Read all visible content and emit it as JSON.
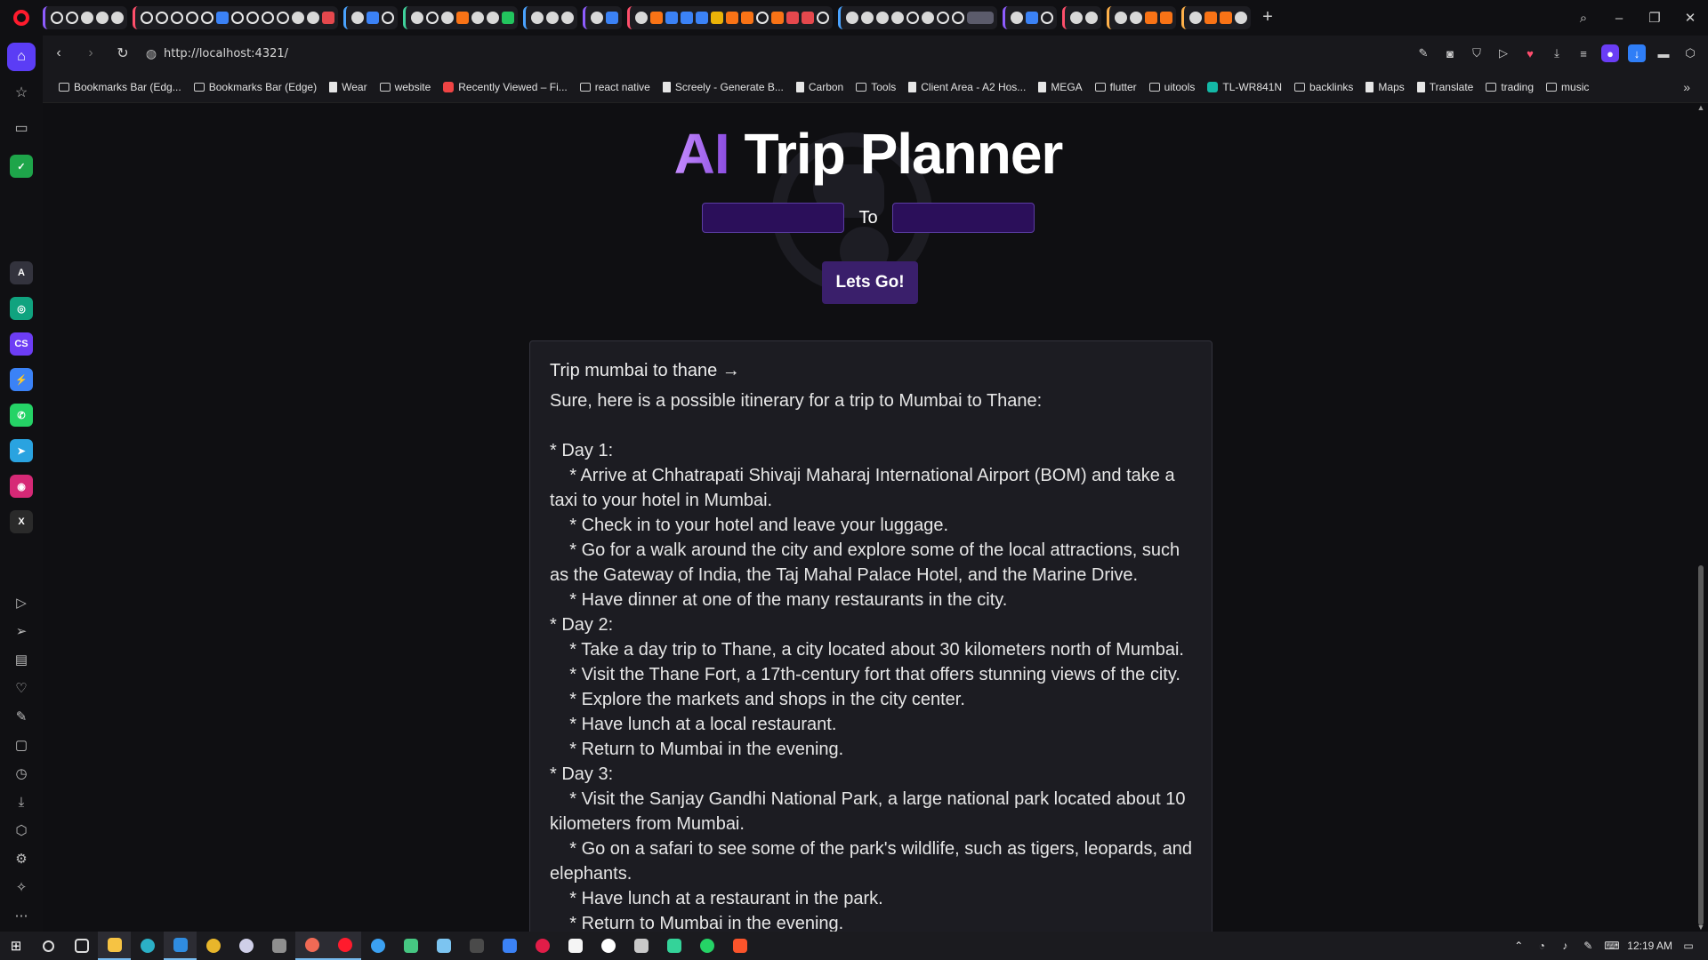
{
  "browser": {
    "url": "http://localhost:4321/",
    "new_tab_label": "+",
    "window_controls": {
      "search": "⌕",
      "minimize": "–",
      "restore": "❐",
      "close": "✕"
    }
  },
  "bookmarks": [
    {
      "label": "Bookmarks Bar (Edg...",
      "icon": "folder-icon"
    },
    {
      "label": "Bookmarks Bar (Edge)",
      "icon": "folder-icon"
    },
    {
      "label": "Wear",
      "icon": "doc-icon"
    },
    {
      "label": "website",
      "icon": "folder-icon"
    },
    {
      "label": "Recently Viewed – Fi...",
      "icon": "figma-icon"
    },
    {
      "label": "react native",
      "icon": "folder-icon"
    },
    {
      "label": "Screely - Generate B...",
      "icon": "doc-icon"
    },
    {
      "label": "Carbon",
      "icon": "doc-icon"
    },
    {
      "label": "Tools",
      "icon": "folder-icon"
    },
    {
      "label": "Client Area - A2 Hos...",
      "icon": "doc-icon"
    },
    {
      "label": "MEGA",
      "icon": "doc-icon"
    },
    {
      "label": "flutter",
      "icon": "folder-icon"
    },
    {
      "label": "uitools",
      "icon": "folder-icon"
    },
    {
      "label": "TL-WR841N",
      "icon": "tplink-icon"
    },
    {
      "label": "backlinks",
      "icon": "folder-icon"
    },
    {
      "label": "Maps",
      "icon": "doc-icon"
    },
    {
      "label": "Translate",
      "icon": "doc-icon"
    },
    {
      "label": "trading",
      "icon": "folder-icon"
    },
    {
      "label": "music",
      "icon": "folder-icon"
    }
  ],
  "planner": {
    "title_accent": "AI",
    "title_rest": " Trip Planner",
    "from_value": "",
    "to_label": "To",
    "to_value": "",
    "go_label": "Lets Go!",
    "result_heading": "Trip mumbai to thane →",
    "result_text": "Sure, here is a possible itinerary for a trip to Mumbai to Thane:\n\n* Day 1:\n    * Arrive at Chhatrapati Shivaji Maharaj International Airport (BOM) and take a taxi to your hotel in Mumbai.\n    * Check in to your hotel and leave your luggage.\n    * Go for a walk around the city and explore some of the local attractions, such as the Gateway of India, the Taj Mahal Palace Hotel, and the Marine Drive.\n    * Have dinner at one of the many restaurants in the city.\n* Day 2:\n    * Take a day trip to Thane, a city located about 30 kilometers north of Mumbai.\n    * Visit the Thane Fort, a 17th-century fort that offers stunning views of the city.\n    * Explore the markets and shops in the city center.\n    * Have lunch at a local restaurant.\n    * Return to Mumbai in the evening.\n* Day 3:\n    * Visit the Sanjay Gandhi National Park, a large national park located about 10 kilometers from Mumbai.\n    * Go on a safari to see some of the park's wildlife, such as tigers, leopards, and elephants.\n    * Have lunch at a restaurant in the park.\n    * Return to Mumbai in the evening."
  },
  "taskbar": {
    "clock": "12:19 AM"
  },
  "colors": {
    "accent_purple": "#8e5cff",
    "input_bg": "#2b0f5a",
    "button_bg": "#3a1f6b",
    "card_bg": "#1c1c22",
    "opera_red": "#ff1b2d"
  }
}
